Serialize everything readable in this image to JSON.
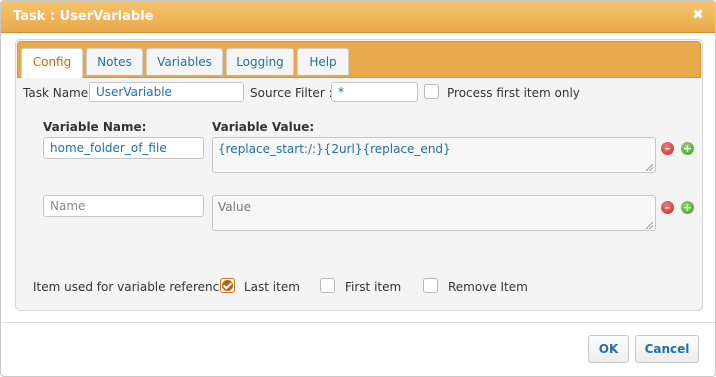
{
  "dialog": {
    "title": "Task : UserVariable",
    "close_icon": "close-icon"
  },
  "tabs": [
    {
      "label": "Config",
      "active": true
    },
    {
      "label": "Notes"
    },
    {
      "label": "Variables"
    },
    {
      "label": "Logging"
    },
    {
      "label": "Help"
    }
  ],
  "config": {
    "task_name_label": "Task Name:",
    "task_name_value": "UserVariable",
    "source_filter_label": "Source Filter :",
    "source_filter_value": "*",
    "process_first_label": "Process first item only",
    "process_first_checked": false
  },
  "variables": {
    "name_header": "Variable Name:",
    "value_header": "Variable Value:",
    "rows": [
      {
        "name": "home_folder_of_file",
        "value": "{replace_start:/:}{2url}{replace_end}"
      },
      {
        "name": "",
        "value": "",
        "name_placeholder": "Name",
        "value_placeholder": "Value"
      }
    ]
  },
  "reference": {
    "label": "Item used for variable reference:",
    "options": [
      {
        "label": "Last item",
        "checked": true
      },
      {
        "label": "First item",
        "checked": false
      },
      {
        "label": "Remove Item",
        "checked": false
      }
    ]
  },
  "buttons": {
    "ok": "OK",
    "cancel": "Cancel"
  },
  "colors": {
    "accent": "#e8a94c",
    "link": "#1f6fa8",
    "remove": "#c42a2a",
    "add": "#3e9a22"
  }
}
